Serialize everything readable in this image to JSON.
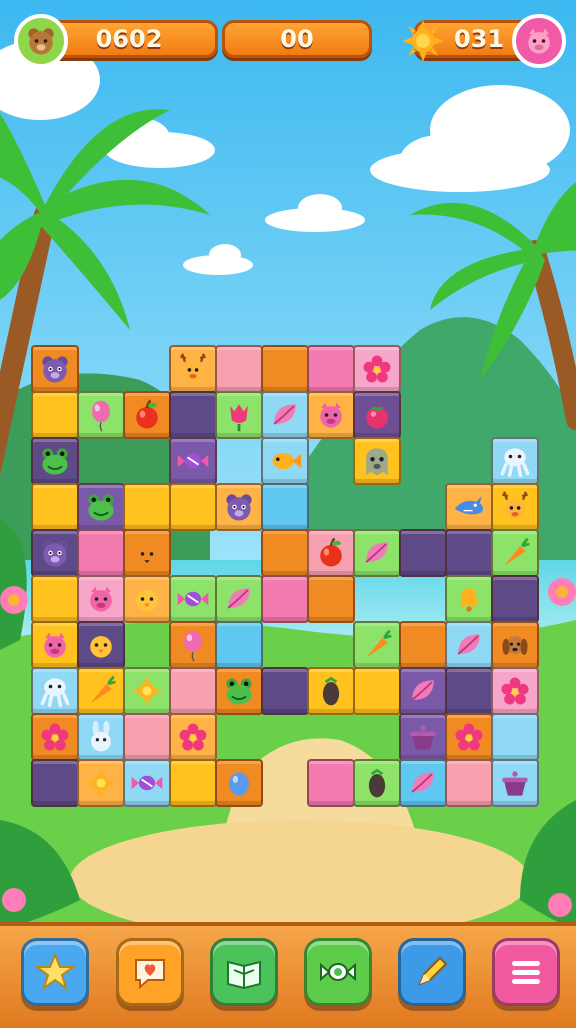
{
  "hud": {
    "score": "0602",
    "center_value": "00",
    "suns": "031"
  },
  "colors": {
    "sky_top": "#3cb8f0",
    "sky_bottom": "#a6e6fb",
    "hud_orange": "#f59024",
    "bottom_bar": "#ee9234"
  },
  "board": {
    "tiles": [
      {
        "c": 0,
        "r": 0,
        "color": "#f08a22",
        "icon": "bear-icon"
      },
      {
        "c": 3,
        "r": 0,
        "color": "#ffb347",
        "icon": "deer-icon"
      },
      {
        "c": 4,
        "r": 0,
        "color": "#f7a0b0",
        "icon": ""
      },
      {
        "c": 5,
        "r": 0,
        "color": "#f08a22",
        "icon": ""
      },
      {
        "c": 6,
        "r": 0,
        "color": "#f37bb0",
        "icon": ""
      },
      {
        "c": 7,
        "r": 0,
        "color": "#f6a6c8",
        "icon": "flower-icon"
      },
      {
        "c": 0,
        "r": 1,
        "color": "#ffc21e",
        "icon": ""
      },
      {
        "c": 1,
        "r": 1,
        "color": "#8de36a",
        "icon": "balloon-icon"
      },
      {
        "c": 2,
        "r": 1,
        "color": "#f08a22",
        "icon": "apple-icon"
      },
      {
        "c": 3,
        "r": 1,
        "color": "#5e4a86",
        "icon": ""
      },
      {
        "c": 4,
        "r": 1,
        "color": "#8de36a",
        "icon": "tulip-icon"
      },
      {
        "c": 5,
        "r": 1,
        "color": "#8fd9f5",
        "icon": "leaf-icon"
      },
      {
        "c": 6,
        "r": 1,
        "color": "#ffb347",
        "icon": "pig-icon"
      },
      {
        "c": 7,
        "r": 1,
        "color": "#6e4f94",
        "icon": "berry-icon"
      },
      {
        "c": 0,
        "r": 2,
        "color": "#5e4a86",
        "icon": "frog-icon"
      },
      {
        "c": 3,
        "r": 2,
        "color": "#7a5aa8",
        "icon": "candy-icon"
      },
      {
        "c": 5,
        "r": 2,
        "color": "#8fd9f5",
        "icon": "fish-icon"
      },
      {
        "c": 7,
        "r": 2,
        "color": "#ffc21e",
        "icon": "ghost-icon"
      },
      {
        "c": 10,
        "r": 2,
        "color": "#8fd9f5",
        "icon": "squid-icon"
      },
      {
        "c": 0,
        "r": 3,
        "color": "#ffc21e",
        "icon": ""
      },
      {
        "c": 1,
        "r": 3,
        "color": "#7a5aa8",
        "icon": "frog-icon"
      },
      {
        "c": 2,
        "r": 3,
        "color": "#ffc21e",
        "icon": ""
      },
      {
        "c": 3,
        "r": 3,
        "color": "#ffc21e",
        "icon": ""
      },
      {
        "c": 4,
        "r": 3,
        "color": "#ffb347",
        "icon": "bear-icon"
      },
      {
        "c": 5,
        "r": 3,
        "color": "#5ec8f0",
        "icon": ""
      },
      {
        "c": 9,
        "r": 3,
        "color": "#ffb347",
        "icon": "shark-icon"
      },
      {
        "c": 10,
        "r": 3,
        "color": "#ffc21e",
        "icon": "deer-icon"
      },
      {
        "c": 0,
        "r": 4,
        "color": "#5e4a86",
        "icon": "bear-icon"
      },
      {
        "c": 1,
        "r": 4,
        "color": "#f37bb0",
        "icon": ""
      },
      {
        "c": 2,
        "r": 4,
        "color": "#f08a22",
        "icon": "fox-icon"
      },
      {
        "c": 5,
        "r": 4,
        "color": "#f08a22",
        "icon": ""
      },
      {
        "c": 6,
        "r": 4,
        "color": "#f7a0b0",
        "icon": "apple-icon"
      },
      {
        "c": 7,
        "r": 4,
        "color": "#8de36a",
        "icon": "leaf-icon"
      },
      {
        "c": 8,
        "r": 4,
        "color": "#5e4a86",
        "icon": ""
      },
      {
        "c": 9,
        "r": 4,
        "color": "#5e4a86",
        "icon": ""
      },
      {
        "c": 10,
        "r": 4,
        "color": "#8de36a",
        "icon": "carrot-icon"
      },
      {
        "c": 0,
        "r": 5,
        "color": "#ffc21e",
        "icon": ""
      },
      {
        "c": 1,
        "r": 5,
        "color": "#f6a6c8",
        "icon": "pig-icon"
      },
      {
        "c": 2,
        "r": 5,
        "color": "#ffb347",
        "icon": "chick-icon"
      },
      {
        "c": 3,
        "r": 5,
        "color": "#8de36a",
        "icon": "candy-icon"
      },
      {
        "c": 4,
        "r": 5,
        "color": "#8de36a",
        "icon": "leaf-icon"
      },
      {
        "c": 5,
        "r": 5,
        "color": "#f37bb0",
        "icon": ""
      },
      {
        "c": 6,
        "r": 5,
        "color": "#f08a22",
        "icon": ""
      },
      {
        "c": 9,
        "r": 5,
        "color": "#8de36a",
        "icon": "bell-icon"
      },
      {
        "c": 10,
        "r": 5,
        "color": "#5e4a86",
        "icon": ""
      },
      {
        "c": 0,
        "r": 6,
        "color": "#ffc21e",
        "icon": "pig-icon"
      },
      {
        "c": 1,
        "r": 6,
        "color": "#5e4a86",
        "icon": "chick-icon"
      },
      {
        "c": 3,
        "r": 6,
        "color": "#f08a22",
        "icon": "balloon-icon"
      },
      {
        "c": 4,
        "r": 6,
        "color": "#5ec8f0",
        "icon": ""
      },
      {
        "c": 7,
        "r": 6,
        "color": "#8de36a",
        "icon": "carrot-icon"
      },
      {
        "c": 8,
        "r": 6,
        "color": "#f08a22",
        "icon": ""
      },
      {
        "c": 9,
        "r": 6,
        "color": "#8fd9f5",
        "icon": "leaf-icon"
      },
      {
        "c": 10,
        "r": 6,
        "color": "#f08a22",
        "icon": "dog-icon"
      },
      {
        "c": 0,
        "r": 7,
        "color": "#8fd9f5",
        "icon": "squid-icon"
      },
      {
        "c": 1,
        "r": 7,
        "color": "#ffc21e",
        "icon": "carrot-icon"
      },
      {
        "c": 2,
        "r": 7,
        "color": "#8de36a",
        "icon": "sun-icon"
      },
      {
        "c": 3,
        "r": 7,
        "color": "#f7a0b0",
        "icon": ""
      },
      {
        "c": 4,
        "r": 7,
        "color": "#f08a22",
        "icon": "frog-icon"
      },
      {
        "c": 5,
        "r": 7,
        "color": "#5e4a86",
        "icon": ""
      },
      {
        "c": 6,
        "r": 7,
        "color": "#ffc21e",
        "icon": "eggplant-icon"
      },
      {
        "c": 7,
        "r": 7,
        "color": "#ffc21e",
        "icon": ""
      },
      {
        "c": 8,
        "r": 7,
        "color": "#7a5aa8",
        "icon": "leaf-icon"
      },
      {
        "c": 9,
        "r": 7,
        "color": "#5e4a86",
        "icon": ""
      },
      {
        "c": 10,
        "r": 7,
        "color": "#f6a6c8",
        "icon": "flower-icon"
      },
      {
        "c": 0,
        "r": 8,
        "color": "#f08a22",
        "icon": "flower-icon"
      },
      {
        "c": 1,
        "r": 8,
        "color": "#8fd9f5",
        "icon": "bunny-icon"
      },
      {
        "c": 2,
        "r": 8,
        "color": "#f7a0b0",
        "icon": ""
      },
      {
        "c": 3,
        "r": 8,
        "color": "#ffb347",
        "icon": "flower-icon"
      },
      {
        "c": 8,
        "r": 8,
        "color": "#7a5aa8",
        "icon": "pot-icon"
      },
      {
        "c": 9,
        "r": 8,
        "color": "#f08a22",
        "icon": "flower-icon"
      },
      {
        "c": 10,
        "r": 8,
        "color": "#8fd9f5",
        "icon": ""
      },
      {
        "c": 0,
        "r": 9,
        "color": "#5e4a86",
        "icon": ""
      },
      {
        "c": 1,
        "r": 9,
        "color": "#ffb347",
        "icon": "sun-icon"
      },
      {
        "c": 2,
        "r": 9,
        "color": "#8fd9f5",
        "icon": "candy-icon"
      },
      {
        "c": 3,
        "r": 9,
        "color": "#ffc21e",
        "icon": ""
      },
      {
        "c": 4,
        "r": 9,
        "color": "#f08a22",
        "icon": "egg-icon"
      },
      {
        "c": 6,
        "r": 9,
        "color": "#f37bb0",
        "icon": ""
      },
      {
        "c": 7,
        "r": 9,
        "color": "#8de36a",
        "icon": "eggplant-icon"
      },
      {
        "c": 8,
        "r": 9,
        "color": "#5ec8f0",
        "icon": "leaf-icon"
      },
      {
        "c": 9,
        "r": 9,
        "color": "#f7a0b0",
        "icon": ""
      },
      {
        "c": 10,
        "r": 9,
        "color": "#8fd9f5",
        "icon": "pot-icon"
      }
    ]
  },
  "toolbar": {
    "buttons": [
      {
        "name": "star-button",
        "icon": "star-icon",
        "color": "#4aa8f0"
      },
      {
        "name": "chat-button",
        "icon": "chat-icon",
        "color": "#ffa326"
      },
      {
        "name": "book-button",
        "icon": "book-icon",
        "color": "#4cc35a"
      },
      {
        "name": "candy-button",
        "icon": "candy-icon",
        "color": "#5ccc4a"
      },
      {
        "name": "pencil-button",
        "icon": "pencil-icon",
        "color": "#3c9ae8"
      },
      {
        "name": "menu-button",
        "icon": "menu-icon",
        "color": "#f25aa0"
      }
    ]
  }
}
